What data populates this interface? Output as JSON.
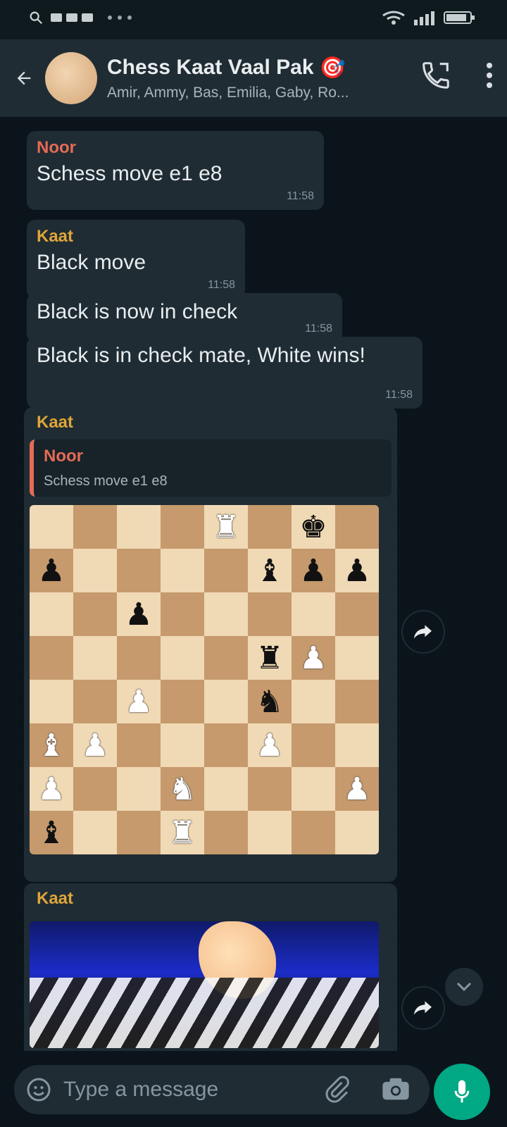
{
  "status_bar": {
    "time": "",
    "left_icons": [
      "search-icon",
      "notification-icon",
      "dot-icon"
    ],
    "right_icons": [
      "wifi-icon",
      "signal-icon",
      "battery-icon"
    ]
  },
  "header": {
    "title": "Chess Kaat Vaal Pak",
    "emoji": "🎯",
    "subtitle": "Amir, Ammy, Bas, Emilia, Gaby, Ro...",
    "icons": {
      "back": "back-arrow-icon",
      "call": "call-icon",
      "menu": "more-vert-icon"
    }
  },
  "messages": [
    {
      "sender": "Noor",
      "text": "Schess move e1 e8",
      "time": "11:58"
    },
    {
      "sender": "Kaat",
      "text": "Black move",
      "time": "11:58"
    },
    {
      "text": "Black is now in check",
      "time": "11:58"
    },
    {
      "text": "Black is in check mate, White wins!",
      "time": "11:58"
    },
    {
      "sender": "Kaat",
      "quote": {
        "sender": "Noor",
        "text": "Schess move e1 e8"
      },
      "board": [
        [
          "",
          "",
          "",
          "",
          "wR",
          "",
          "bK",
          ""
        ],
        [
          "bP",
          "",
          "",
          "",
          "",
          "bB",
          "bP",
          "bP"
        ],
        [
          "",
          "",
          "bP",
          "",
          "",
          "",
          "",
          ""
        ],
        [
          "",
          "",
          "",
          "",
          "",
          "bR",
          "wP",
          ""
        ],
        [
          "",
          "",
          "wP",
          "",
          "",
          "bN",
          "",
          ""
        ],
        [
          "wB",
          "wP",
          "",
          "",
          "",
          "wP",
          "",
          ""
        ],
        [
          "wP",
          "",
          "",
          "wN",
          "",
          "",
          "",
          "wP"
        ],
        [
          "bB",
          "",
          "",
          "wR",
          "",
          "",
          "",
          ""
        ]
      ]
    },
    {
      "sender": "Kaat",
      "image": "chess-hand-photo"
    }
  ],
  "composer": {
    "placeholder": "Type a message",
    "icons": [
      "emoji-icon",
      "attach-icon",
      "camera-icon",
      "mic-icon"
    ]
  }
}
